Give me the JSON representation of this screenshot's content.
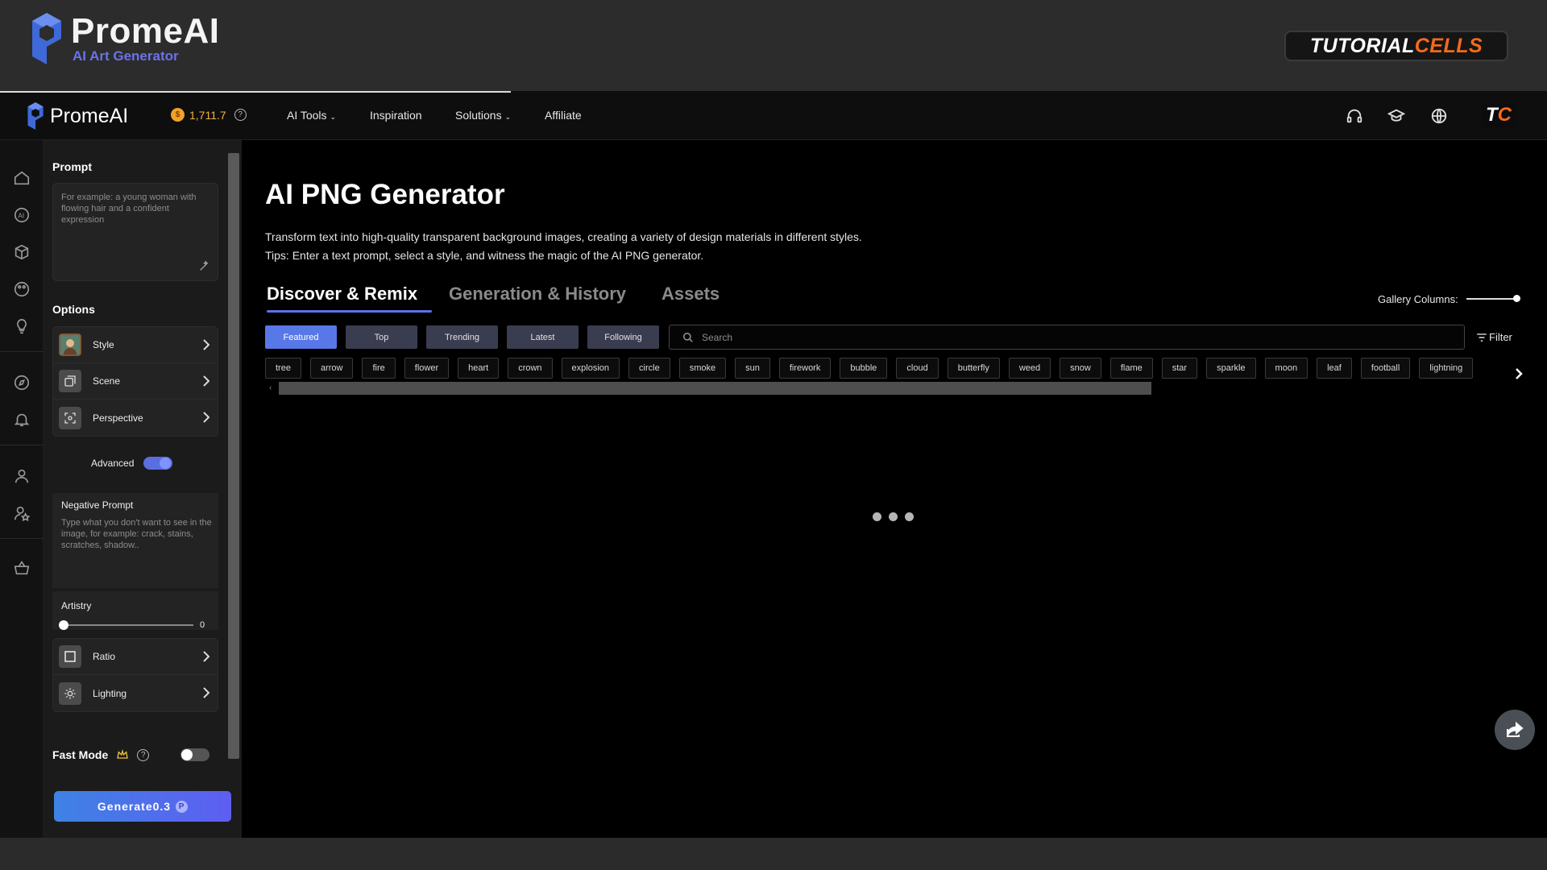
{
  "banner": {
    "brand": "PromeAI",
    "tagline": "AI Art Generator",
    "badge_part1": "TUTORIAL",
    "badge_part2": "CELLS"
  },
  "navbar": {
    "brand": "PromeAI",
    "credits": "1,711.7",
    "menu": [
      "AI Tools",
      "Inspiration",
      "Solutions",
      "Affiliate"
    ],
    "avatar_t": "T",
    "avatar_c": "C"
  },
  "panel": {
    "prompt_title": "Prompt",
    "prompt_placeholder": "For example: a young woman with flowing hair and a confident expression",
    "options_title": "Options",
    "options": [
      "Style",
      "Scene",
      "Perspective"
    ],
    "advanced_label": "Advanced",
    "negative_title": "Negative Prompt",
    "negative_placeholder": "Type what you don't want to see in the image, for example: crack, stains, scratches, shadow..",
    "artistry_label": "Artistry",
    "artistry_value": "0",
    "bottom_options": [
      "Ratio",
      "Lighting"
    ],
    "fast_mode_label": "Fast Mode",
    "generate_label": "Generate0.3"
  },
  "main": {
    "title": "AI PNG Generator",
    "desc_line1": "Transform text into high-quality transparent background images, creating a variety of design materials in different styles.",
    "desc_line2": "Tips: Enter a text prompt, select a style, and witness the magic of the AI PNG generator.",
    "tabs": [
      "Discover & Remix",
      "Generation & History",
      "Assets"
    ],
    "gallery_label": "Gallery Columns:",
    "chips": [
      "Featured",
      "Top",
      "Trending",
      "Latest",
      "Following"
    ],
    "search_placeholder": "Search",
    "filter_label": "Filter",
    "tags": [
      "tree",
      "arrow",
      "fire",
      "flower",
      "heart",
      "crown",
      "explosion",
      "circle",
      "smoke",
      "sun",
      "firework",
      "bubble",
      "cloud",
      "butterfly",
      "weed",
      "snow",
      "flame",
      "star",
      "sparkle",
      "moon",
      "leaf",
      "football",
      "lightning"
    ]
  },
  "colors": {
    "accent": "#5878e8",
    "credits": "#f2b33c",
    "brand_orange": "#f36b1c"
  }
}
